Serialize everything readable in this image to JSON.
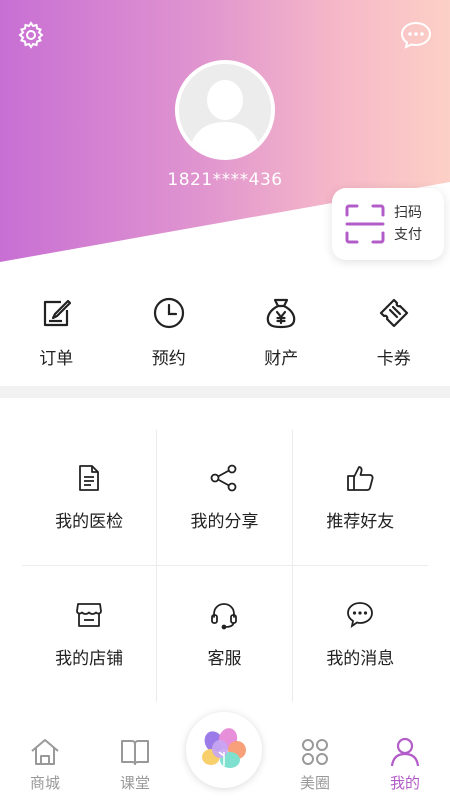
{
  "header": {
    "phone": "1821****436",
    "scan_pay": {
      "line1": "扫码",
      "line2": "支付"
    },
    "icons": {
      "settings": "gear-icon",
      "messages": "chat-bubble-icon",
      "avatar": "user-avatar"
    }
  },
  "shortcuts": [
    {
      "label": "订单",
      "icon": "order-icon"
    },
    {
      "label": "预约",
      "icon": "clock-icon"
    },
    {
      "label": "财产",
      "icon": "money-bag-icon"
    },
    {
      "label": "卡券",
      "icon": "ticket-icon"
    }
  ],
  "grid": [
    {
      "label": "我的医检",
      "icon": "document-icon"
    },
    {
      "label": "我的分享",
      "icon": "share-icon"
    },
    {
      "label": "推荐好友",
      "icon": "thumbs-up-icon"
    },
    {
      "label": "我的店铺",
      "icon": "shop-icon"
    },
    {
      "label": "客服",
      "icon": "headset-icon"
    },
    {
      "label": "我的消息",
      "icon": "message-icon"
    }
  ],
  "nav": [
    {
      "label": "商城",
      "icon": "home-icon",
      "active": false
    },
    {
      "label": "课堂",
      "icon": "book-icon",
      "active": false
    },
    {
      "label": "",
      "icon": "flower-logo-icon",
      "active": false
    },
    {
      "label": "美圈",
      "icon": "circles-icon",
      "active": false
    },
    {
      "label": "我的",
      "icon": "person-icon",
      "active": true
    }
  ],
  "colors": {
    "accent": "#b25cc8",
    "gradient_start": "#c86fd4",
    "gradient_end": "#fcd0c6",
    "nav_inactive": "#999999"
  }
}
